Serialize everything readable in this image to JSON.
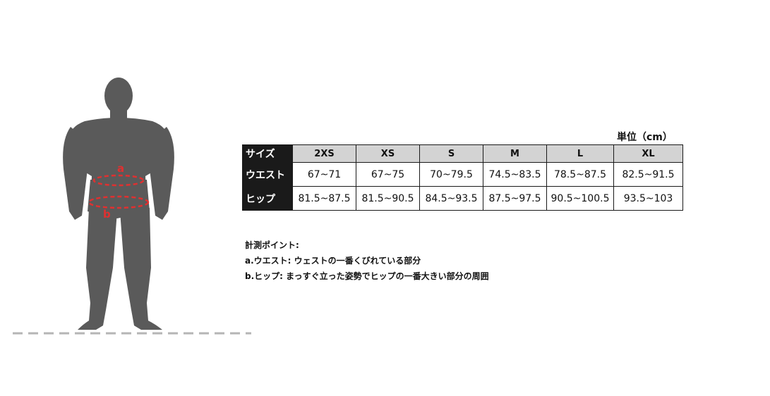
{
  "figure": {
    "label_a": "a",
    "label_b": "b",
    "body_color": "#5a5a5a",
    "marker_color": "#e03030",
    "ground_color": "#b5b5b5"
  },
  "unit_label": "単位（cm）",
  "table": {
    "row_labels": [
      "サイズ",
      "ウエスト",
      "ヒップ"
    ],
    "sizes": [
      "2XS",
      "XS",
      "S",
      "M",
      "L",
      "XL"
    ],
    "waist": [
      "67~71",
      "67~75",
      "70~79.5",
      "74.5~83.5",
      "78.5~87.5",
      "82.5~91.5"
    ],
    "hip": [
      "81.5~87.5",
      "81.5~90.5",
      "84.5~93.5",
      "87.5~97.5",
      "90.5~100.5",
      "93.5~103"
    ],
    "header_bg": "#d3d3d3",
    "rowhead_bg": "#1a1a1a"
  },
  "notes": {
    "title": "計測ポイント:",
    "a": "a.ウエスト: ウェストの一番くびれている部分",
    "b": "b.ヒップ: まっすぐ立った姿勢でヒップの一番大きい部分の周囲"
  }
}
